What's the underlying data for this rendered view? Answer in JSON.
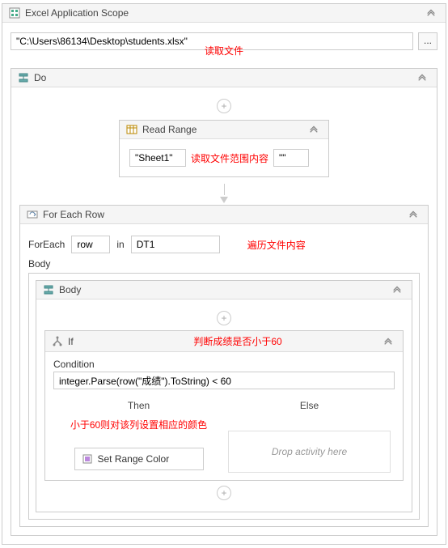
{
  "excel_scope": {
    "title": "Excel Application Scope",
    "path": "\"C:\\Users\\86134\\Desktop\\students.xlsx\"",
    "browse": "...",
    "annotation1": "读取文件"
  },
  "do_seq": {
    "title": "Do"
  },
  "read_range": {
    "title": "Read Range",
    "sheet": "\"Sheet1\"",
    "range": "\"\"",
    "annotation": "读取文件范围内容"
  },
  "for_each": {
    "title": "For Each Row",
    "foreach_label": "ForEach",
    "var": "row",
    "in_label": "in",
    "collection": "DT1",
    "annotation": "遍历文件内容",
    "body_label": "Body"
  },
  "body_seq": {
    "title": "Body"
  },
  "if_act": {
    "title": "If",
    "annotation": "判断成绩是否小于60",
    "condition_label": "Condition",
    "condition": "integer.Parse(row(\"成绩\").ToString) < 60",
    "then_label": "Then",
    "else_label": "Else",
    "then_annotation": "小于60则对该列设置相应的颜色",
    "drop_hint": "Drop activity here"
  },
  "set_range_color": {
    "title": "Set Range Color"
  }
}
